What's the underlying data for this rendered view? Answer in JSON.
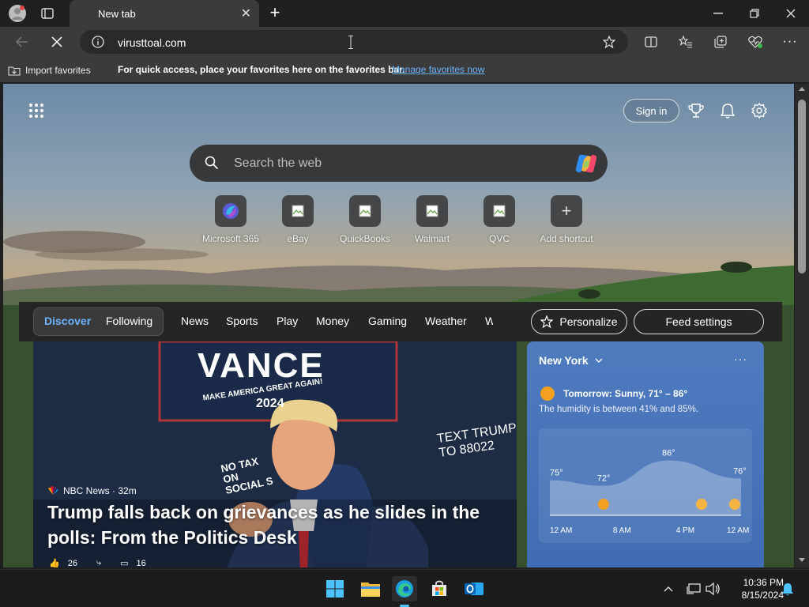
{
  "window": {
    "tab_title": "New tab",
    "new_tab_symbol": "+",
    "minimize_symbol": "—",
    "restore_symbol": "❐",
    "close_symbol": "✕"
  },
  "toolbar": {
    "url": "virusttoal.com"
  },
  "favorites_bar": {
    "import_label": "Import favorites",
    "message": "For quick access, place your favorites here on the favorites bar.",
    "manage_link": "Manage favorites now"
  },
  "ntp": {
    "sign_in": "Sign in",
    "search_placeholder": "Search the web",
    "shortcuts": [
      {
        "label": "Microsoft 365"
      },
      {
        "label": "eBay"
      },
      {
        "label": "QuickBooks"
      },
      {
        "label": "Walmart"
      },
      {
        "label": "QVC"
      },
      {
        "label": "Add shortcut"
      }
    ]
  },
  "feed": {
    "tabs": [
      "Discover",
      "Following",
      "News",
      "Sports",
      "Play",
      "Money",
      "Gaming",
      "Weather",
      "W"
    ],
    "personalize": "Personalize",
    "feed_settings": "Feed settings"
  },
  "news": {
    "source": "NBC News · 32m",
    "headline": "Trump falls back on grievances as he slides in the polls: From the Politics Desk",
    "sign_text_1": "VANCE",
    "sign_text_2": "MAKE AMERICA GREAT AGAIN!",
    "sign_text_3": "2024",
    "sign_text_4": "TEXT TRUMP\nTO 88022",
    "sign_text_5": "NO TAX\nON\nSOCIAL S",
    "likes": "26",
    "comments": "16"
  },
  "weather": {
    "city": "New York",
    "summary": "Tomorrow: Sunny, 71° – 86°",
    "detail": "The humidity is between 41% and 85%.",
    "temps": [
      {
        "label": "75°",
        "value": 75
      },
      {
        "label": "72°",
        "value": 72
      },
      {
        "label": "86°",
        "value": 86
      },
      {
        "label": "76°",
        "value": 76
      }
    ],
    "times": [
      "12 AM",
      "8 AM",
      "4 PM",
      "12 AM"
    ]
  },
  "taskbar": {
    "time": "10:36 PM",
    "date": "8/15/2024"
  },
  "colors": {
    "accent": "#3a8ee6",
    "link": "#6cb4ff"
  }
}
